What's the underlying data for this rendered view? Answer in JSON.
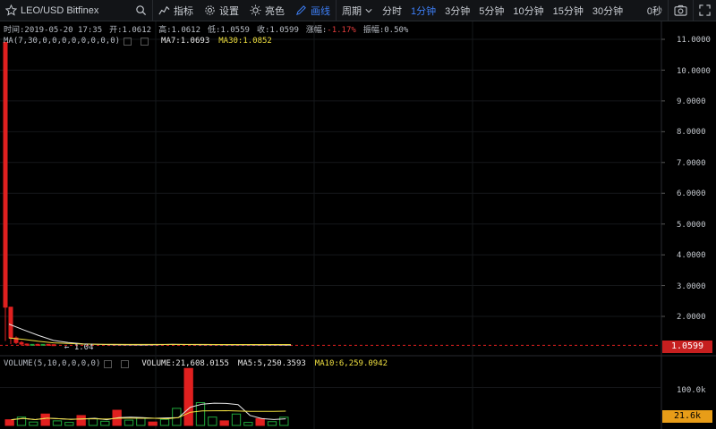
{
  "toolbar": {
    "symbol": "LEO/USD Bitfinex",
    "indicators": "指标",
    "settings": "设置",
    "theme": "亮色",
    "draw": "画线",
    "period": "周期",
    "intervals": [
      "分时",
      "1分钟",
      "3分钟",
      "5分钟",
      "10分钟",
      "15分钟",
      "30分钟"
    ],
    "active_interval": "1分钟",
    "countdown": "0秒"
  },
  "info_bar": {
    "time": "时间:2019-05-20 17:35",
    "open": "开:1.0612",
    "high": "高:1.0612",
    "low": "低:1.0559",
    "close": "收:1.0599",
    "change_label": "涨幅:",
    "change_value": "-1.17%",
    "amplitude": "振幅:0.50%"
  },
  "price_legend": {
    "ma_params": "MA(7,30,0,0,0,0,0,0,0,0)",
    "ma7": "MA7:1.0693",
    "ma30": "MA30:1.0852"
  },
  "volume_legend": {
    "params": "VOLUME(5,10,0,0,0,0)",
    "volume": "VOLUME:21,608.0155",
    "ma5": "MA5:5,250.3593",
    "ma10": "MA10:6,259.0942"
  },
  "price_axis": [
    "11.0000",
    "10.0000",
    "9.0000",
    "8.0000",
    "7.0000",
    "6.0000",
    "5.0000",
    "4.0000",
    "3.0000",
    "2.0000"
  ],
  "volume_axis": [
    "100.0k"
  ],
  "last_price": "1.0599",
  "current_volume": "21.6k",
  "min_price_label": "← 1.04",
  "colors": {
    "up": "#1fa83a",
    "down": "#e0201f",
    "ma7": "#e8e8e8",
    "ma30": "#f0e040",
    "active": "#3d7ef5"
  },
  "chart_data": [
    {
      "type": "candlestick",
      "title": "LEO/USD Bitfinex",
      "ylim": [
        1.0,
        11.2
      ],
      "series": [
        {
          "name": "MA7",
          "values": [
            1.75,
            1.56,
            1.38,
            1.22,
            1.15,
            1.11,
            1.09,
            1.08,
            1.075,
            1.07,
            1.08,
            1.09,
            1.085,
            1.08,
            1.078,
            1.075,
            1.073,
            1.072,
            1.07,
            1.069
          ]
        },
        {
          "name": "MA30",
          "values": [
            1.3,
            1.25,
            1.19,
            1.14,
            1.12,
            1.1,
            1.095,
            1.09,
            1.088,
            1.087,
            1.087,
            1.088,
            1.088,
            1.087,
            1.086,
            1.086,
            1.086,
            1.085,
            1.085,
            1.085
          ]
        }
      ],
      "candles": [
        {
          "o": 10.9,
          "h": 10.9,
          "l": 1.2,
          "c": 2.3
        },
        {
          "o": 2.3,
          "h": 2.3,
          "l": 1.1,
          "c": 1.3
        },
        {
          "o": 1.3,
          "h": 1.35,
          "l": 1.1,
          "c": 1.15
        },
        {
          "o": 1.15,
          "h": 1.2,
          "l": 1.05,
          "c": 1.1
        },
        {
          "o": 1.1,
          "h": 1.12,
          "l": 1.04,
          "c": 1.08
        },
        {
          "o": 1.08,
          "h": 1.1,
          "l": 1.05,
          "c": 1.09
        },
        {
          "o": 1.09,
          "h": 1.11,
          "l": 1.06,
          "c": 1.07
        },
        {
          "o": 1.07,
          "h": 1.1,
          "l": 1.06,
          "c": 1.09
        },
        {
          "o": 1.09,
          "h": 1.1,
          "l": 1.07,
          "c": 1.08
        },
        {
          "o": 1.08,
          "h": 1.09,
          "l": 1.06,
          "c": 1.065
        }
      ],
      "last": 1.0599
    },
    {
      "type": "bar",
      "title": "VOLUME",
      "ylim": [
        0,
        160000
      ],
      "values": [
        15000,
        22000,
        9000,
        30000,
        12000,
        8000,
        26000,
        18000,
        11000,
        40000,
        14000,
        20000,
        9000,
        16000,
        45000,
        150000,
        60000,
        22000,
        12000,
        30000,
        8000,
        18000,
        10000,
        21608
      ]
    }
  ]
}
